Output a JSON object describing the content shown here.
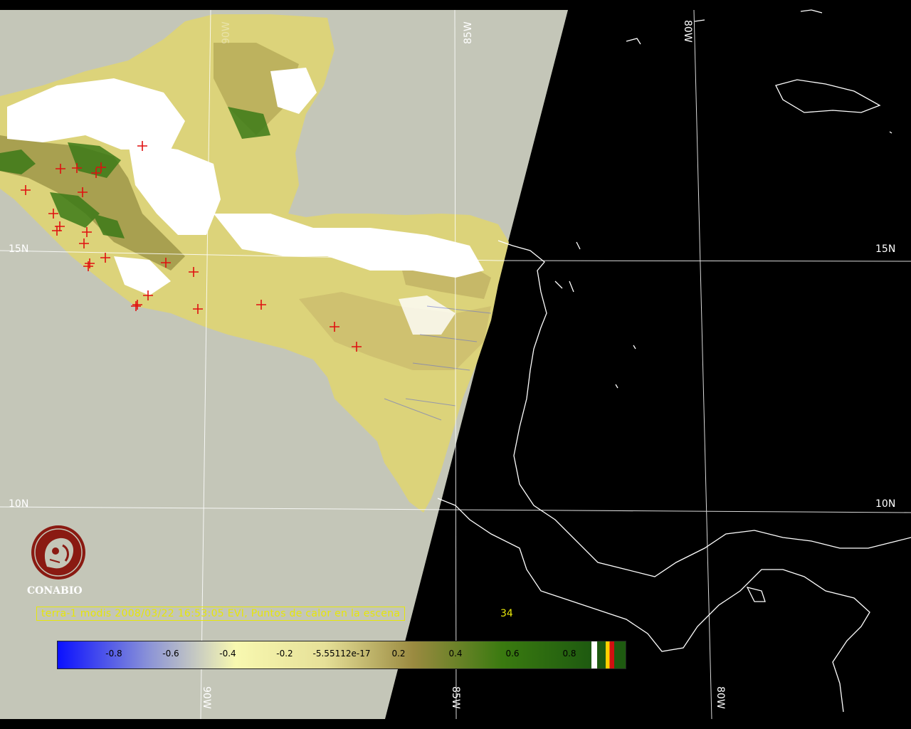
{
  "map": {
    "grid_labels": {
      "lat_15n_left": "15N",
      "lat_15n_right": "15N",
      "lat_10n_left": "10N",
      "lat_10n_right": "10N",
      "lon_85w_top": "85W",
      "lon_85w_bottom": "85W",
      "lon_80w_top": "80W",
      "lon_80w_bottom": "80W",
      "lon_90w_bottom": "90W",
      "lon_90w_top": "90W"
    },
    "colors": {
      "no_data_background": "#c4c6b8",
      "night_side": "#000000",
      "coastline": "#ffffff",
      "graticule": "#ffffff",
      "cloud": "#ffffff",
      "fire_marker": "#e01010",
      "caption_text": "#e6e60a"
    },
    "fire_point_count_shown": 34
  },
  "caption": {
    "text": "terra-1 modis 2008/03/22 16:53:05 EVI, Puntos de calor en la escena",
    "count": "34"
  },
  "logo": {
    "text": "CONABIO",
    "icon": "conabio-seal-icon"
  },
  "legend": {
    "ticks": [
      "-0.8",
      "-0.6",
      "-0.4",
      "-0.2",
      "-5.55112e-17",
      "0.2",
      "0.4",
      "0.6",
      "0.8"
    ],
    "gradient_colors": [
      "#0a10ff",
      "#8890d8",
      "#f8f8b0",
      "#e6e098",
      "#9a8a40",
      "#3a7a10",
      "#1e5a10"
    ]
  }
}
